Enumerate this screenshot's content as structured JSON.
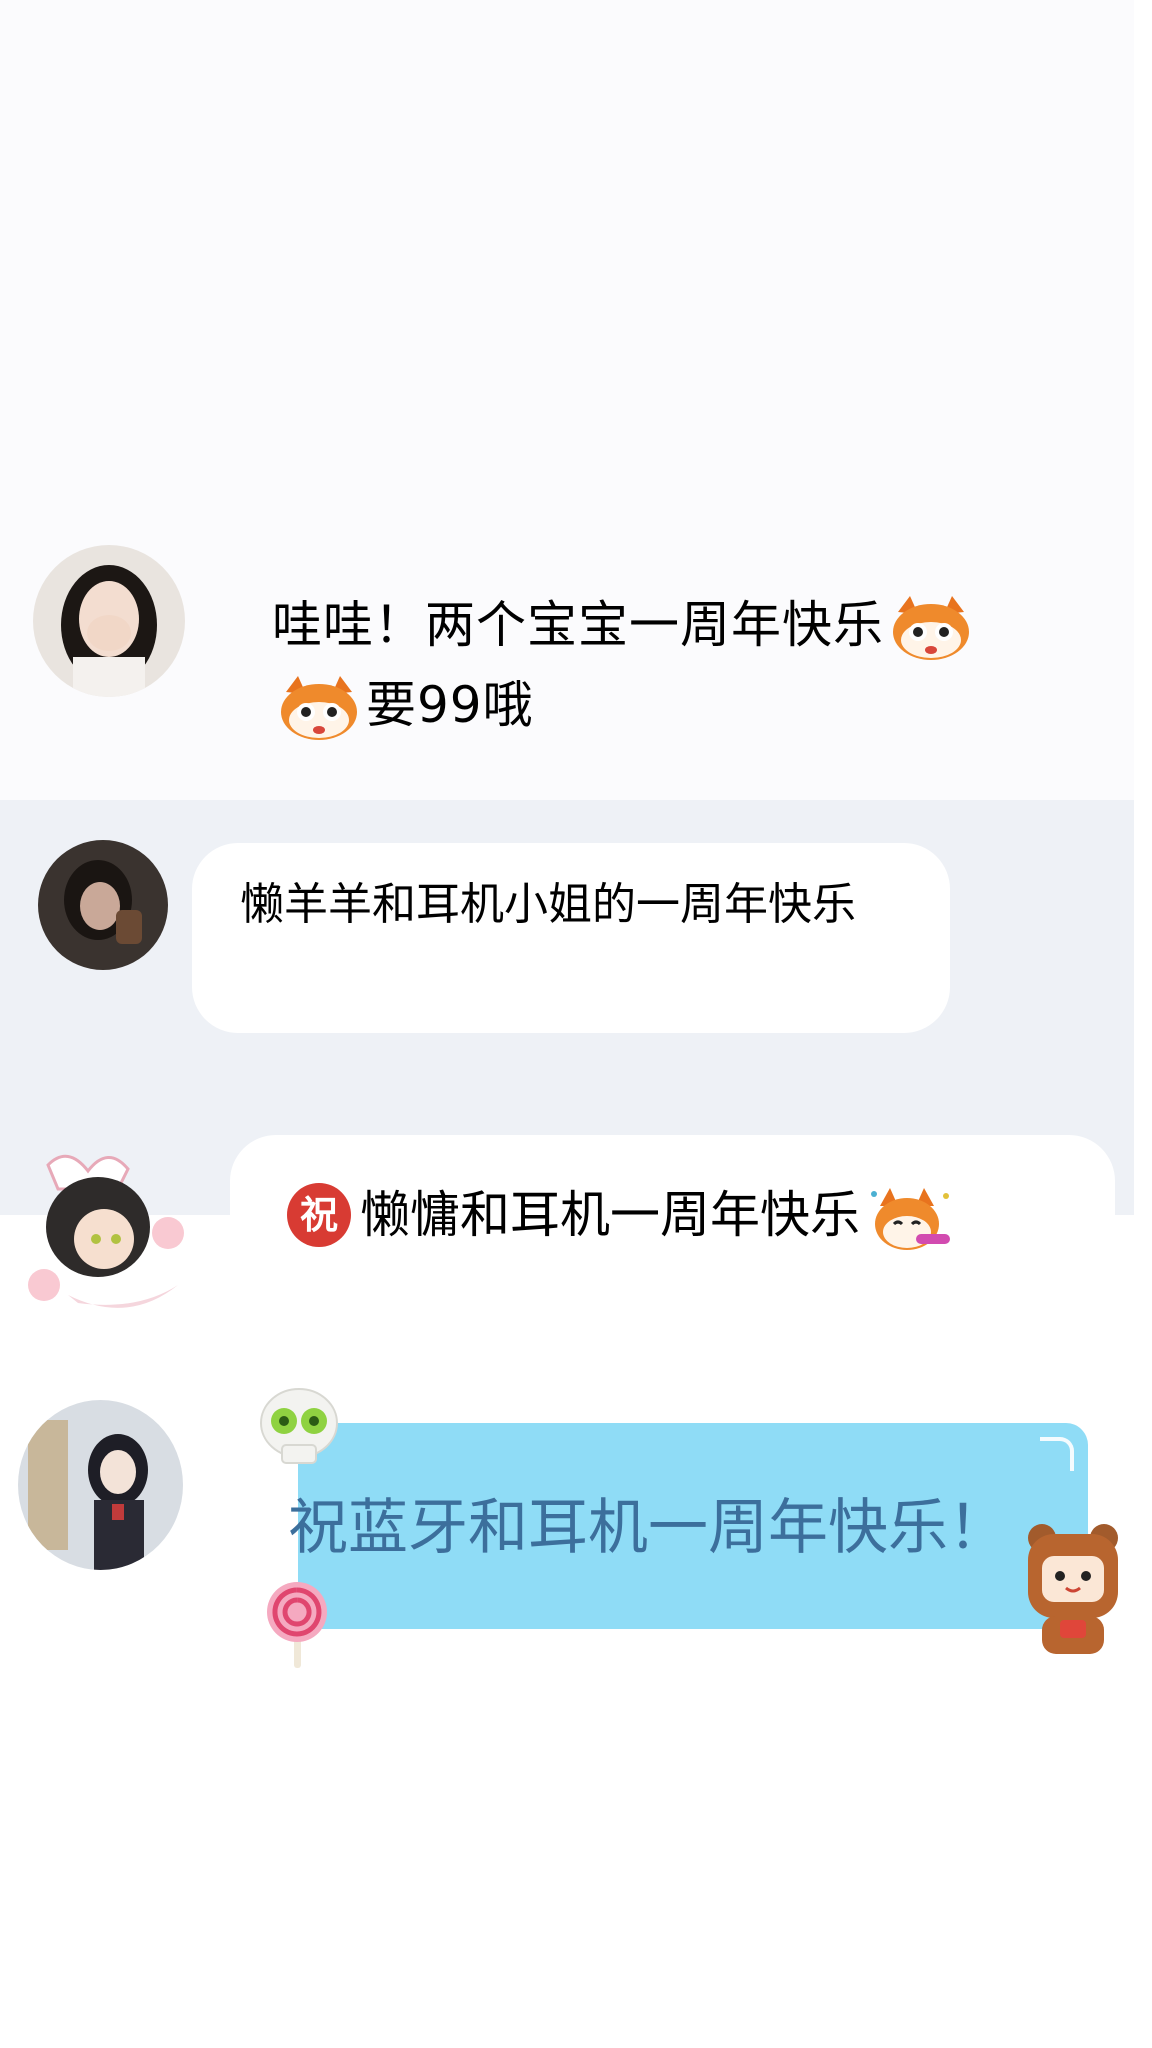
{
  "messages": [
    {
      "line1": "哇哇！两个宝宝一周年快乐",
      "line2": "要99哦",
      "emoji": "cat-face-sticker"
    },
    {
      "text": "懒羊羊和耳机小姐的一周年快乐"
    },
    {
      "badge": "祝",
      "text": "懒慵和耳机一周年快乐",
      "emoji": "party-cat-sticker"
    },
    {
      "text": "祝蓝牙和耳机一周年快乐！",
      "decorations": [
        "skull-sticker",
        "lollipop-sticker",
        "bear-sticker"
      ]
    }
  ],
  "colors": {
    "bubble_highlight": "#8fdcf6",
    "badge_red": "#d83b33",
    "band_gray": "#eef1f6"
  }
}
